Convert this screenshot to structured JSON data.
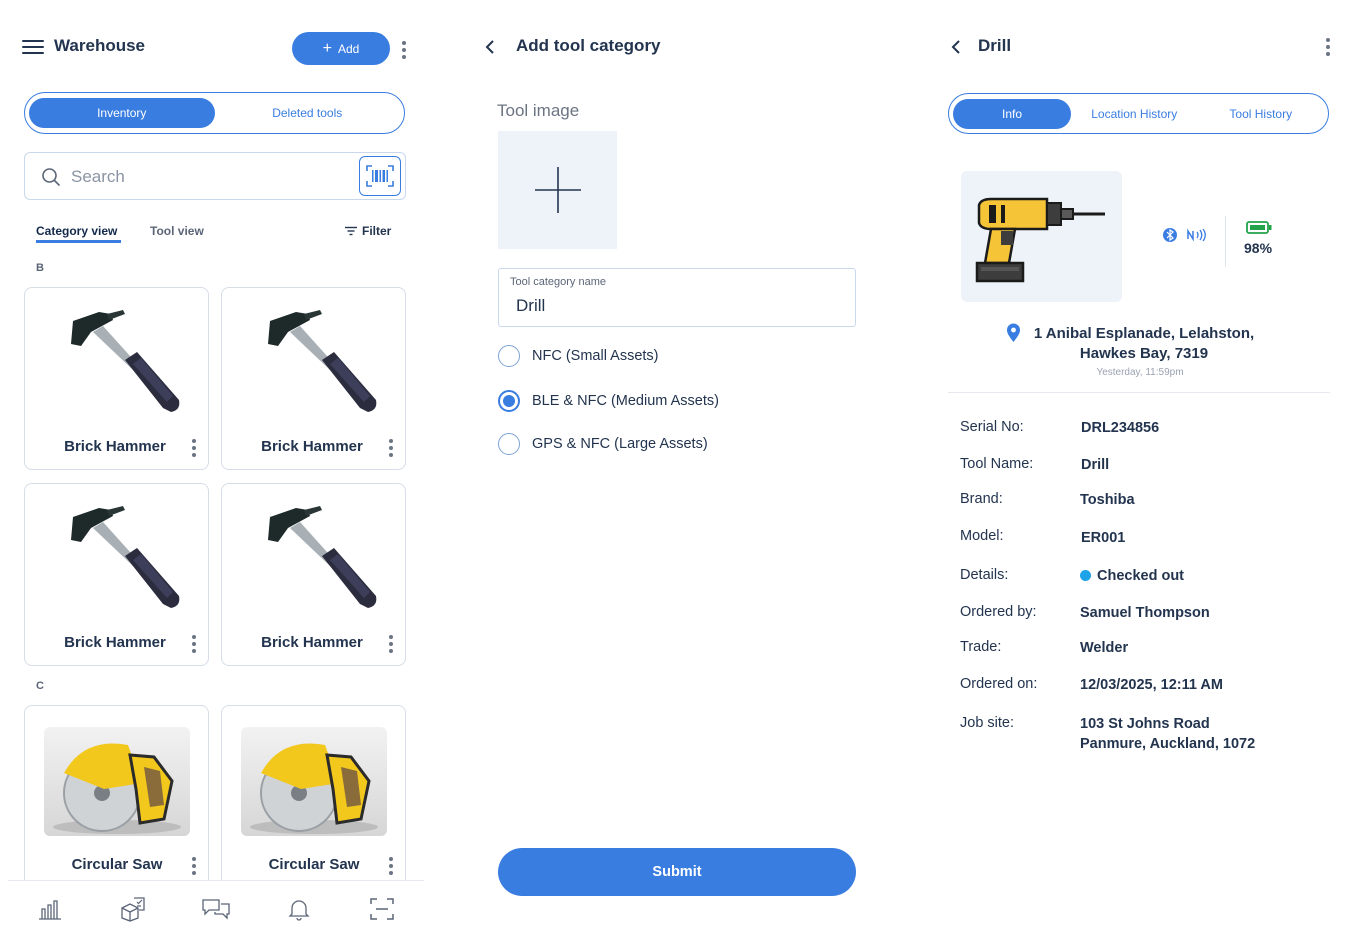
{
  "warehouse": {
    "title": "Warehouse",
    "add_label": "Add",
    "tabs": [
      "Inventory",
      "Deleted tools"
    ],
    "search_placeholder": "Search",
    "subtabs": [
      "Category view",
      "Tool view"
    ],
    "filter_label": "Filter",
    "sections": [
      {
        "letter": "B",
        "items": [
          "Brick Hammer",
          "Brick Hammer",
          "Brick Hammer",
          "Brick Hammer"
        ]
      },
      {
        "letter": "C",
        "items": [
          "Circular Saw",
          "Circular Saw"
        ]
      }
    ],
    "bottom_nav": [
      "chart-icon",
      "inventory-box-icon",
      "chat-icon",
      "bell-icon",
      "scan-icon"
    ]
  },
  "add_category": {
    "title": "Add tool category",
    "tool_image_label": "Tool image",
    "name_label": "Tool category name",
    "name_value": "Drill",
    "options": [
      "NFC (Small Assets)",
      "BLE & NFC (Medium Assets)",
      "GPS & NFC (Large Assets)"
    ],
    "selected_option": "BLE & NFC (Medium Assets)",
    "submit_label": "Submit"
  },
  "drill": {
    "title": "Drill",
    "tabs": [
      "Info",
      "Location History",
      "Tool History"
    ],
    "battery": "98%",
    "address_line1": "1 Anibal Esplanade, Lelahston,",
    "address_line2": "Hawkes Bay, 7319",
    "address_time": "Yesterday, 11:59pm",
    "info": {
      "serial_k": "Serial No:",
      "serial_v": "DRL234856",
      "name_k": "Tool Name:",
      "name_v": "Drill",
      "brand_k": "Brand:",
      "brand_v": "Toshiba",
      "model_k": "Model:",
      "model_v": "ER001",
      "details_k": "Details:",
      "details_v": "Checked out",
      "ordered_by_k": "Ordered by:",
      "ordered_by_v": "Samuel Thompson",
      "trade_k": "Trade:",
      "trade_v": "Welder",
      "ordered_on_k": "Ordered on:",
      "ordered_on_v": "12/03/2025, 12:11 AM",
      "job_site_k": "Job site:",
      "job_site_v1": "103 St Johns Road",
      "job_site_v2": "Panmure, Auckland, 1072"
    }
  },
  "colors": {
    "primary": "#3a7de1",
    "text": "#23344f",
    "status_checked_out": "#1ea3e8",
    "battery": "#22a34a"
  }
}
